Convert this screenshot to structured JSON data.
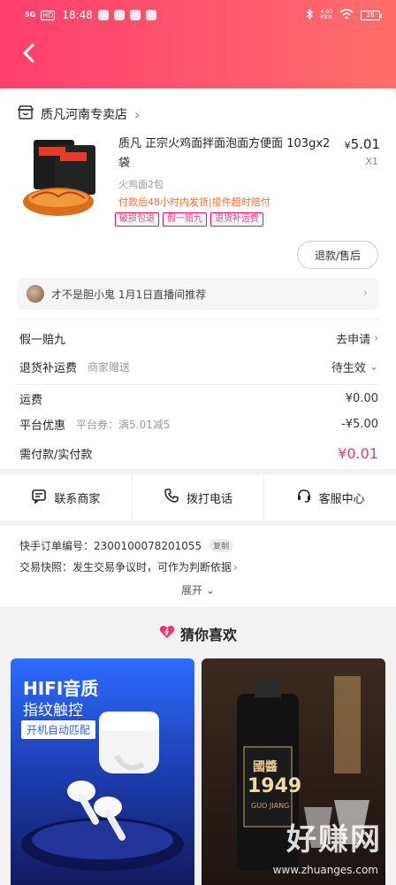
{
  "status_bar": {
    "signal": "5G",
    "hd": "HD",
    "time": "18:48",
    "net_speed": "4.60\nKB/s",
    "battery": "26"
  },
  "shop": {
    "name": "质凡河南专卖店",
    "chevron": "›"
  },
  "product": {
    "title": "质凡 正宗火鸡面拌面泡面方便面 103gx2袋",
    "price_currency": "¥",
    "price": "5.01",
    "quantity": "X1",
    "spec": "火鸡面2包",
    "ship_note": "付款后48小时内发货|揽件超时赔付",
    "tags": [
      "破损包退",
      "假一赔九",
      "退货补运费"
    ]
  },
  "refund_button": "退款/售后",
  "source": {
    "text": "才不是胆小鬼  1月1日直播间推荐",
    "chevron": "›"
  },
  "service_rows": [
    {
      "label": "假一赔九",
      "sub": "",
      "value": "去申请"
    },
    {
      "label": "退货补运费",
      "sub": "商家赠送",
      "value": "待生效"
    }
  ],
  "fee_rows": [
    {
      "label": "运费",
      "sub": "",
      "value": "¥0.00"
    },
    {
      "label": "平台优惠",
      "sub": "平台券：满5.01减5",
      "value": "-¥5.00"
    },
    {
      "label": "需付款/实付款",
      "sub": "",
      "value": "¥0.01"
    }
  ],
  "actions": [
    {
      "label": "联系商家",
      "icon": "chat-icon"
    },
    {
      "label": "拨打电话",
      "icon": "phone-icon"
    },
    {
      "label": "客服中心",
      "icon": "headset-icon"
    }
  ],
  "order_meta": {
    "order_no_label": "快手订单编号：",
    "order_no": "2300100078201055",
    "copy_label": "复制",
    "snapshot_label": "交易快照：",
    "snapshot_text": "发生交易争议时，可作为判断依据",
    "expand_label": "展开"
  },
  "recommend": {
    "title": "猜你喜欢",
    "left_card": {
      "line1": "HIFI音质",
      "line2": "指纹触控",
      "line3": "开机自动匹配"
    },
    "right_card": {
      "brand": "國醬",
      "year": "1949",
      "sub": "GUO JIANG"
    }
  },
  "watermark": {
    "big": "好赚网",
    "small": "www.zhuanges.com"
  },
  "colors": {
    "brand": "#ff4a6e",
    "accent": "#f0356a",
    "orange": "#ff6a2a"
  }
}
